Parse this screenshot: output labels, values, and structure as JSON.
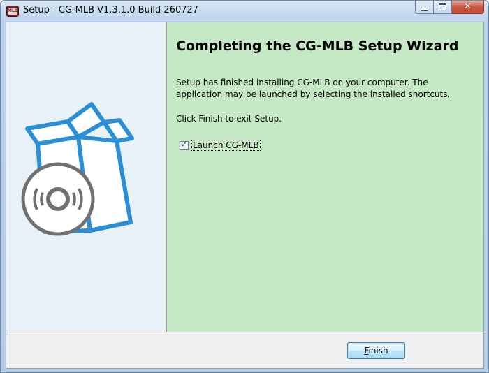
{
  "window": {
    "title": "Setup - CG-MLB V1.3.1.0 Build 260727",
    "app_icon_text": "MLB"
  },
  "colors": {
    "content_bg": "#c5e8c5",
    "side_panel_bg": "#e8f0f8",
    "box_blue": "#2a8fd6",
    "disc_gray": "#707070"
  },
  "icons": {
    "minimize": "minimize-icon",
    "maximize": "maximize-icon",
    "close": "close-icon",
    "illustration": "software-box-disc-icon"
  },
  "content": {
    "heading": "Completing the CG-MLB Setup Wizard",
    "description": "Setup has finished installing CG-MLB on your computer. The application may be launched by selecting the installed shortcuts.",
    "finish_hint": "Click Finish to exit Setup.",
    "launch_checkbox": {
      "label": "Launch CG-MLB",
      "checked": true
    }
  },
  "footer": {
    "finish_label_underlined": "F",
    "finish_label_rest": "inish"
  }
}
